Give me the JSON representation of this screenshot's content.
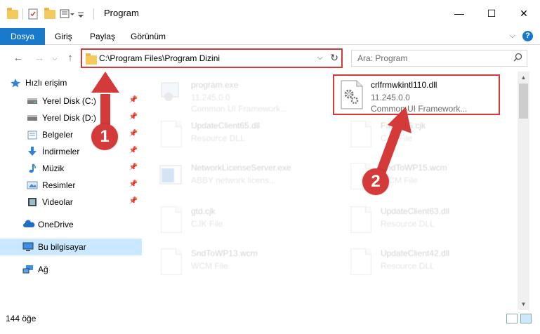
{
  "window": {
    "title": "Program",
    "minimize": "—",
    "maximize": "☐",
    "close": "✕"
  },
  "ribbon": {
    "tabs": [
      "Dosya",
      "Giriş",
      "Paylaş",
      "Görünüm"
    ],
    "active_tab": "Dosya",
    "accent": "#1979ca",
    "help": "?"
  },
  "address_bar": {
    "path": "C:\\Program Files\\Program Dizini"
  },
  "search": {
    "placeholder": "Ara: Program"
  },
  "sidebar": {
    "items": [
      {
        "label": "Hızlı erişim",
        "icon": "star-icon"
      },
      {
        "label": "Yerel Disk (C:)",
        "icon": "drive-icon",
        "pinned": true
      },
      {
        "label": "Yerel Disk (D:)",
        "icon": "drive-icon",
        "pinned": true
      },
      {
        "label": "Belgeler",
        "icon": "documents-icon",
        "pinned": true
      },
      {
        "label": "İndirmeler",
        "icon": "download-icon",
        "pinned": true
      },
      {
        "label": "Müzik",
        "icon": "music-icon",
        "pinned": true
      },
      {
        "label": "Resimler",
        "icon": "pictures-icon",
        "pinned": true
      },
      {
        "label": "Videolar",
        "icon": "video-icon",
        "pinned": true
      },
      {
        "label": "OneDrive",
        "icon": "cloud-icon"
      },
      {
        "label": "Bu bilgisayar",
        "icon": "computer-icon",
        "selected": true
      },
      {
        "label": "Ağ",
        "icon": "network-icon"
      }
    ]
  },
  "files": [
    {
      "name": "program.exe",
      "line1": "11.245.0.0",
      "line2": "Common UI Framework...",
      "faded": true
    },
    {
      "name": "crlfrmwkintl110.dll",
      "line1": "11.245.0.0",
      "line2": "Common UI Framework...",
      "faded": false
    },
    {
      "name": "UpdateClient65.dll",
      "line1": "Resource DLL",
      "line2": "",
      "faded": true
    },
    {
      "name": "Fasdsd5.cjk",
      "line1": "CJK File",
      "line2": "",
      "faded": true
    },
    {
      "name": "NetworkLicenseServer.exe",
      "line1": "ABBY network licens...",
      "line2": "",
      "faded": true
    },
    {
      "name": "SndToWP15.wcm",
      "line1": "WCM File",
      "line2": "",
      "faded": true
    },
    {
      "name": "gtd.cjk",
      "line1": "CJK File",
      "line2": "",
      "faded": true
    },
    {
      "name": "UpdateClient63.dll",
      "line1": "Resource DLL",
      "line2": "",
      "faded": true
    },
    {
      "name": "SndToWP13.wcm",
      "line1": "WCM File",
      "line2": "",
      "faded": true
    },
    {
      "name": "UpdateClient42.dll",
      "line1": "Resource DLL",
      "line2": "",
      "faded": true
    }
  ],
  "status": {
    "item_count": "144 öğe"
  },
  "callouts": [
    "1",
    "2"
  ],
  "colors": {
    "highlight": "#d53a3a",
    "selection": "#cce8ff"
  }
}
